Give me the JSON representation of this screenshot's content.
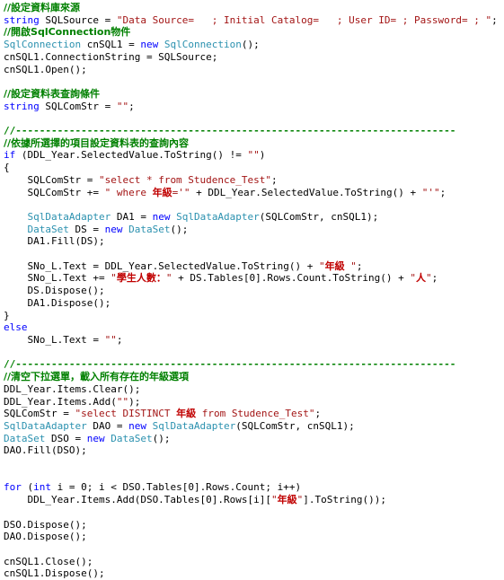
{
  "document": {
    "title": "C# ASP.NET SqlConnection code listing",
    "language": "C#",
    "background_color": "#ffffff"
  },
  "colors": {
    "comment": "#008000",
    "keyword": "#0000ff",
    "type": "#2b91af",
    "string": "#a31515",
    "cjk_string": "#c00000",
    "plain": "#000000"
  },
  "code": {
    "lines": [
      {
        "id": 1,
        "tokens": [
          {
            "t": "comment",
            "v": "//設定資料庫來源"
          }
        ]
      },
      {
        "id": 2,
        "tokens": [
          {
            "t": "keyword",
            "v": "string"
          },
          {
            "t": "plain",
            "v": " SQLSource = "
          },
          {
            "t": "string",
            "v": "\"Data Source=   ; Initial Catalog=   ; User ID= ; Password= ; \""
          },
          {
            "t": "plain",
            "v": ";"
          }
        ]
      },
      {
        "id": 3,
        "tokens": [
          {
            "t": "comment",
            "v": "//開啟SqlConnection物件"
          }
        ]
      },
      {
        "id": 4,
        "tokens": [
          {
            "t": "type",
            "v": "SqlConnection"
          },
          {
            "t": "plain",
            "v": " cnSQL1 = "
          },
          {
            "t": "keyword",
            "v": "new"
          },
          {
            "t": "plain",
            "v": " "
          },
          {
            "t": "type",
            "v": "SqlConnection"
          },
          {
            "t": "plain",
            "v": "();"
          }
        ]
      },
      {
        "id": 5,
        "tokens": [
          {
            "t": "plain",
            "v": "cnSQL1.ConnectionString = SQLSource;"
          }
        ]
      },
      {
        "id": 6,
        "tokens": [
          {
            "t": "plain",
            "v": "cnSQL1.Open();"
          }
        ]
      },
      {
        "id": 7,
        "tokens": [
          {
            "t": "plain",
            "v": ""
          }
        ]
      },
      {
        "id": 8,
        "tokens": [
          {
            "t": "comment",
            "v": "//設定資料表查詢條件"
          }
        ]
      },
      {
        "id": 9,
        "tokens": [
          {
            "t": "keyword",
            "v": "string"
          },
          {
            "t": "plain",
            "v": " SQLComStr = "
          },
          {
            "t": "string",
            "v": "\"\""
          },
          {
            "t": "plain",
            "v": ";"
          }
        ]
      },
      {
        "id": 10,
        "tokens": [
          {
            "t": "plain",
            "v": ""
          }
        ]
      },
      {
        "id": 11,
        "tokens": [
          {
            "t": "comment",
            "v": "//--------------------------------------------------------------------------"
          }
        ]
      },
      {
        "id": 12,
        "tokens": [
          {
            "t": "comment",
            "v": "//依據所選擇的項目設定資料表的查詢內容"
          }
        ]
      },
      {
        "id": 13,
        "tokens": [
          {
            "t": "keyword",
            "v": "if"
          },
          {
            "t": "plain",
            "v": " (DDL_Year.SelectedValue.ToString() != "
          },
          {
            "t": "string",
            "v": "\"\""
          },
          {
            "t": "plain",
            "v": ")"
          }
        ]
      },
      {
        "id": 14,
        "tokens": [
          {
            "t": "plain",
            "v": "{"
          }
        ]
      },
      {
        "id": 15,
        "tokens": [
          {
            "t": "plain",
            "v": "    SQLComStr = "
          },
          {
            "t": "string",
            "v": "\"select * from Studence_Test\""
          },
          {
            "t": "plain",
            "v": ";"
          }
        ]
      },
      {
        "id": 16,
        "tokens": [
          {
            "t": "plain",
            "v": "    SQLComStr += "
          },
          {
            "t": "string",
            "v": "\" where "
          },
          {
            "t": "cjkstr",
            "v": "年級"
          },
          {
            "t": "string",
            "v": "='\""
          },
          {
            "t": "plain",
            "v": " + DDL_Year.SelectedValue.ToString() + "
          },
          {
            "t": "string",
            "v": "\"'\""
          },
          {
            "t": "plain",
            "v": ";"
          }
        ]
      },
      {
        "id": 17,
        "tokens": [
          {
            "t": "plain",
            "v": ""
          }
        ]
      },
      {
        "id": 18,
        "tokens": [
          {
            "t": "plain",
            "v": "    "
          },
          {
            "t": "type",
            "v": "SqlDataAdapter"
          },
          {
            "t": "plain",
            "v": " DA1 = "
          },
          {
            "t": "keyword",
            "v": "new"
          },
          {
            "t": "plain",
            "v": " "
          },
          {
            "t": "type",
            "v": "SqlDataAdapter"
          },
          {
            "t": "plain",
            "v": "(SQLComStr, cnSQL1);"
          }
        ]
      },
      {
        "id": 19,
        "tokens": [
          {
            "t": "plain",
            "v": "    "
          },
          {
            "t": "type",
            "v": "DataSet"
          },
          {
            "t": "plain",
            "v": " DS = "
          },
          {
            "t": "keyword",
            "v": "new"
          },
          {
            "t": "plain",
            "v": " "
          },
          {
            "t": "type",
            "v": "DataSet"
          },
          {
            "t": "plain",
            "v": "();"
          }
        ]
      },
      {
        "id": 20,
        "tokens": [
          {
            "t": "plain",
            "v": "    DA1.Fill(DS);"
          }
        ]
      },
      {
        "id": 21,
        "tokens": [
          {
            "t": "plain",
            "v": ""
          }
        ]
      },
      {
        "id": 22,
        "tokens": [
          {
            "t": "plain",
            "v": "    SNo_L.Text = DDL_Year.SelectedValue.ToString() + "
          },
          {
            "t": "string",
            "v": "\""
          },
          {
            "t": "cjkstr",
            "v": "年級"
          },
          {
            "t": "string",
            "v": " \""
          },
          {
            "t": "plain",
            "v": ";"
          }
        ]
      },
      {
        "id": 23,
        "tokens": [
          {
            "t": "plain",
            "v": "    SNo_L.Text += "
          },
          {
            "t": "string",
            "v": "\""
          },
          {
            "t": "cjkstr",
            "v": "學生人數："
          },
          {
            "t": "string",
            "v": "\""
          },
          {
            "t": "plain",
            "v": " + DS.Tables[0].Rows.Count.ToString() + "
          },
          {
            "t": "string",
            "v": "\""
          },
          {
            "t": "cjkstr",
            "v": "人"
          },
          {
            "t": "string",
            "v": "\""
          },
          {
            "t": "plain",
            "v": ";"
          }
        ]
      },
      {
        "id": 24,
        "tokens": [
          {
            "t": "plain",
            "v": "    DS.Dispose();"
          }
        ]
      },
      {
        "id": 25,
        "tokens": [
          {
            "t": "plain",
            "v": "    DA1.Dispose();"
          }
        ]
      },
      {
        "id": 26,
        "tokens": [
          {
            "t": "plain",
            "v": "}"
          }
        ]
      },
      {
        "id": 27,
        "tokens": [
          {
            "t": "keyword",
            "v": "else"
          }
        ]
      },
      {
        "id": 28,
        "tokens": [
          {
            "t": "plain",
            "v": "    SNo_L.Text = "
          },
          {
            "t": "string",
            "v": "\"\""
          },
          {
            "t": "plain",
            "v": ";"
          }
        ]
      },
      {
        "id": 29,
        "tokens": [
          {
            "t": "plain",
            "v": ""
          }
        ]
      },
      {
        "id": 30,
        "tokens": [
          {
            "t": "comment",
            "v": "//--------------------------------------------------------------------------"
          }
        ]
      },
      {
        "id": 31,
        "tokens": [
          {
            "t": "comment",
            "v": "//清空下拉選單，載入所有存在的年級選項"
          }
        ]
      },
      {
        "id": 32,
        "tokens": [
          {
            "t": "plain",
            "v": "DDL_Year.Items.Clear();"
          }
        ]
      },
      {
        "id": 33,
        "tokens": [
          {
            "t": "plain",
            "v": "DDL_Year.Items.Add("
          },
          {
            "t": "string",
            "v": "\"\""
          },
          {
            "t": "plain",
            "v": ");"
          }
        ]
      },
      {
        "id": 34,
        "tokens": [
          {
            "t": "plain",
            "v": "SQLComStr = "
          },
          {
            "t": "string",
            "v": "\"select DISTINCT "
          },
          {
            "t": "cjkstr",
            "v": "年級"
          },
          {
            "t": "string",
            "v": " from Studence_Test\""
          },
          {
            "t": "plain",
            "v": ";"
          }
        ]
      },
      {
        "id": 35,
        "tokens": [
          {
            "t": "type",
            "v": "SqlDataAdapter"
          },
          {
            "t": "plain",
            "v": " DAO = "
          },
          {
            "t": "keyword",
            "v": "new"
          },
          {
            "t": "plain",
            "v": " "
          },
          {
            "t": "type",
            "v": "SqlDataAdapter"
          },
          {
            "t": "plain",
            "v": "(SQLComStr, cnSQL1);"
          }
        ]
      },
      {
        "id": 36,
        "tokens": [
          {
            "t": "type",
            "v": "DataSet"
          },
          {
            "t": "plain",
            "v": " DSO = "
          },
          {
            "t": "keyword",
            "v": "new"
          },
          {
            "t": "plain",
            "v": " "
          },
          {
            "t": "type",
            "v": "DataSet"
          },
          {
            "t": "plain",
            "v": "();"
          }
        ]
      },
      {
        "id": 37,
        "tokens": [
          {
            "t": "plain",
            "v": "DAO.Fill(DSO);"
          }
        ]
      },
      {
        "id": 38,
        "tokens": [
          {
            "t": "plain",
            "v": ""
          }
        ]
      },
      {
        "id": 39,
        "tokens": [
          {
            "t": "plain",
            "v": ""
          }
        ]
      },
      {
        "id": 40,
        "tokens": [
          {
            "t": "keyword",
            "v": "for"
          },
          {
            "t": "plain",
            "v": " ("
          },
          {
            "t": "keyword",
            "v": "int"
          },
          {
            "t": "plain",
            "v": " i = 0; i < DSO.Tables[0].Rows.Count; i++)"
          }
        ]
      },
      {
        "id": 41,
        "tokens": [
          {
            "t": "plain",
            "v": "    DDL_Year.Items.Add(DSO.Tables[0].Rows[i]["
          },
          {
            "t": "string",
            "v": "\""
          },
          {
            "t": "cjkstr",
            "v": "年級"
          },
          {
            "t": "string",
            "v": "\""
          },
          {
            "t": "plain",
            "v": "].ToString());"
          }
        ]
      },
      {
        "id": 42,
        "tokens": [
          {
            "t": "plain",
            "v": ""
          }
        ]
      },
      {
        "id": 43,
        "tokens": [
          {
            "t": "plain",
            "v": "DSO.Dispose();"
          }
        ]
      },
      {
        "id": 44,
        "tokens": [
          {
            "t": "plain",
            "v": "DAO.Dispose();"
          }
        ]
      },
      {
        "id": 45,
        "tokens": [
          {
            "t": "plain",
            "v": ""
          }
        ]
      },
      {
        "id": 46,
        "tokens": [
          {
            "t": "plain",
            "v": "cnSQL1.Close();"
          }
        ]
      },
      {
        "id": 47,
        "tokens": [
          {
            "t": "plain",
            "v": "cnSQL1.Dispose();"
          }
        ]
      }
    ]
  }
}
